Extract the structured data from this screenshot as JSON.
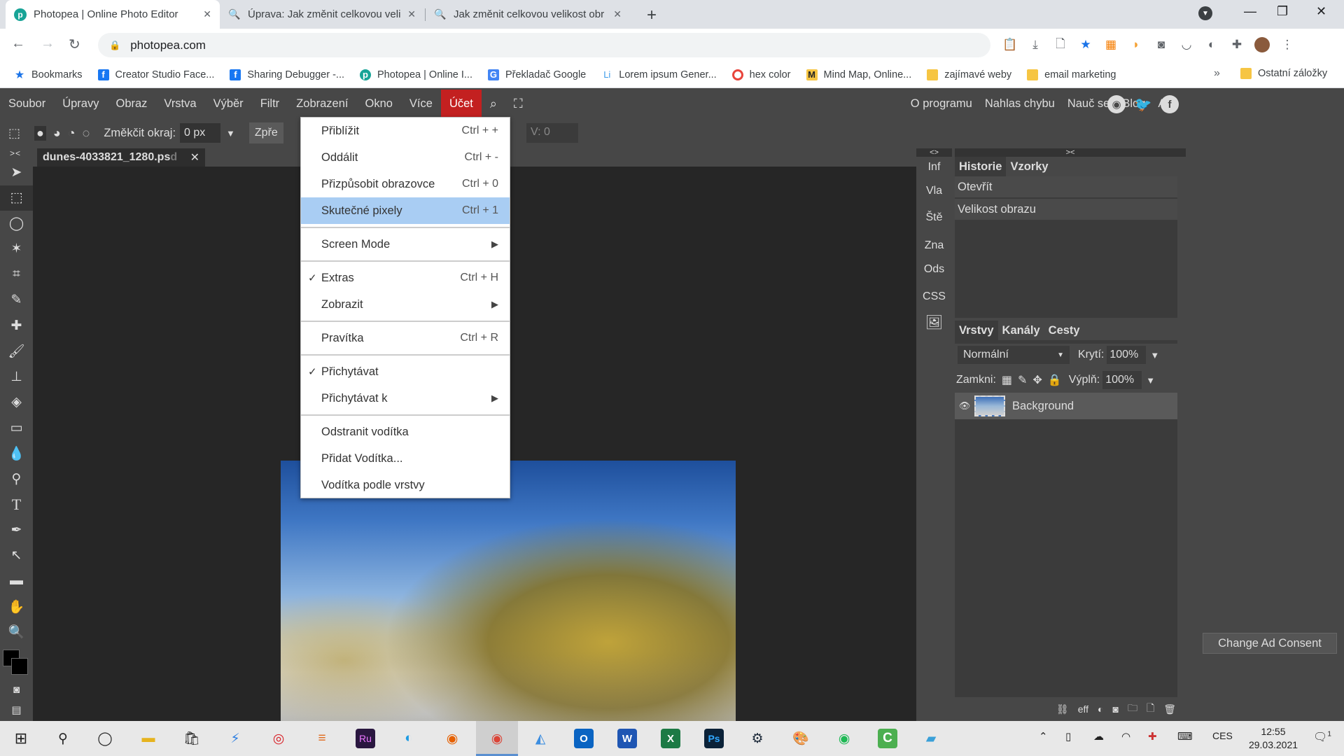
{
  "browser": {
    "tabs": [
      {
        "title": "Photopea | Online Photo Editor",
        "icon": "photopea-icon"
      },
      {
        "title": "Úprava: Jak změnit celkovou veli",
        "icon": "search-icon"
      },
      {
        "title": "Jak změnit celkovou velikost obr",
        "icon": "search-icon"
      }
    ],
    "url": "photopea.com",
    "bookmarks": [
      {
        "label": "Bookmarks",
        "color": "#1a73e8"
      },
      {
        "label": "Creator Studio Face...",
        "color": "#1877f2"
      },
      {
        "label": "Sharing Debugger -...",
        "color": "#1877f2"
      },
      {
        "label": "Photopea | Online I...",
        "color": "#18a497"
      },
      {
        "label": "Překladač Google",
        "color": "#4285f4"
      },
      {
        "label": "Lorem ipsum Gener...",
        "color": "#3d9be9"
      },
      {
        "label": "hex color",
        "color": "#e8453c"
      },
      {
        "label": "Mind Map, Online...",
        "color": "#222222"
      },
      {
        "label": "zajímavé weby",
        "color": "#f6c543"
      },
      {
        "label": "email marketing",
        "color": "#f6c543"
      }
    ],
    "bookmarks_more": "»",
    "other_bookmarks": "Ostatní záložky"
  },
  "app": {
    "menu": [
      "Soubor",
      "Úpravy",
      "Obraz",
      "Vrstva",
      "Výběr",
      "Filtr",
      "Zobrazení",
      "Okno",
      "Více",
      "Účet"
    ],
    "menu_right": [
      "O programu",
      "Nahlas chybu",
      "Nauč se",
      "Blog",
      "API"
    ],
    "options": {
      "feather_label": "Změkčit okraj:",
      "feather_value": "0 px",
      "refine_label": "Zpře",
      "v_label": "V: 0"
    },
    "document_tab": {
      "name": "dunes-4033821_1280.ps",
      "faded": "d",
      "close": "✕"
    },
    "view_menu": [
      {
        "label": "Přiblížit",
        "shortcut": "Ctrl + +"
      },
      {
        "label": "Oddálit",
        "shortcut": "Ctrl + -"
      },
      {
        "label": "Přizpůsobit obrazovce",
        "shortcut": "Ctrl + 0"
      },
      {
        "label": "Skutečné pixely",
        "shortcut": "Ctrl + 1"
      },
      {
        "label": "Screen Mode",
        "submenu": "▶"
      },
      {
        "label": "Extras",
        "shortcut": "Ctrl + H",
        "check": "✓"
      },
      {
        "label": "Zobrazit",
        "submenu": "▶"
      },
      {
        "label": "Pravítka",
        "shortcut": "Ctrl + R"
      },
      {
        "label": "Přichytávat",
        "check": "✓"
      },
      {
        "label": "Přichytávat k",
        "submenu": "▶"
      },
      {
        "label": "Odstranit vodítka"
      },
      {
        "label": "Přidat Vodítka..."
      },
      {
        "label": "Vodítka podle vrstvy"
      }
    ],
    "mini_panel": [
      "Inf",
      "Vla",
      "Ště",
      "Zna",
      "Ods",
      "CSS"
    ],
    "panel_collapse_left": "<>",
    "panel_collapse_right": "><",
    "toolbar_collapse": "><",
    "history": {
      "tabs": [
        "Historie",
        "Vzorky"
      ],
      "items": [
        "Otevřít",
        "Velikost obrazu"
      ]
    },
    "layers": {
      "tabs": [
        "Vrstvy",
        "Kanály",
        "Cesty"
      ],
      "blend_mode": "Normální",
      "opacity_label": "Krytí:",
      "opacity_value": "100%",
      "lock_label": "Zamkni:",
      "fill_label": "Výplň:",
      "fill_value": "100%",
      "layer_name": "Background",
      "eff_label": "eff"
    },
    "consent_button": "Change Ad Consent",
    "accent": "#c32020"
  },
  "taskbar": {
    "lang": "CES",
    "time": "12:55",
    "date": "29.03.2021",
    "notification_count": "1"
  }
}
